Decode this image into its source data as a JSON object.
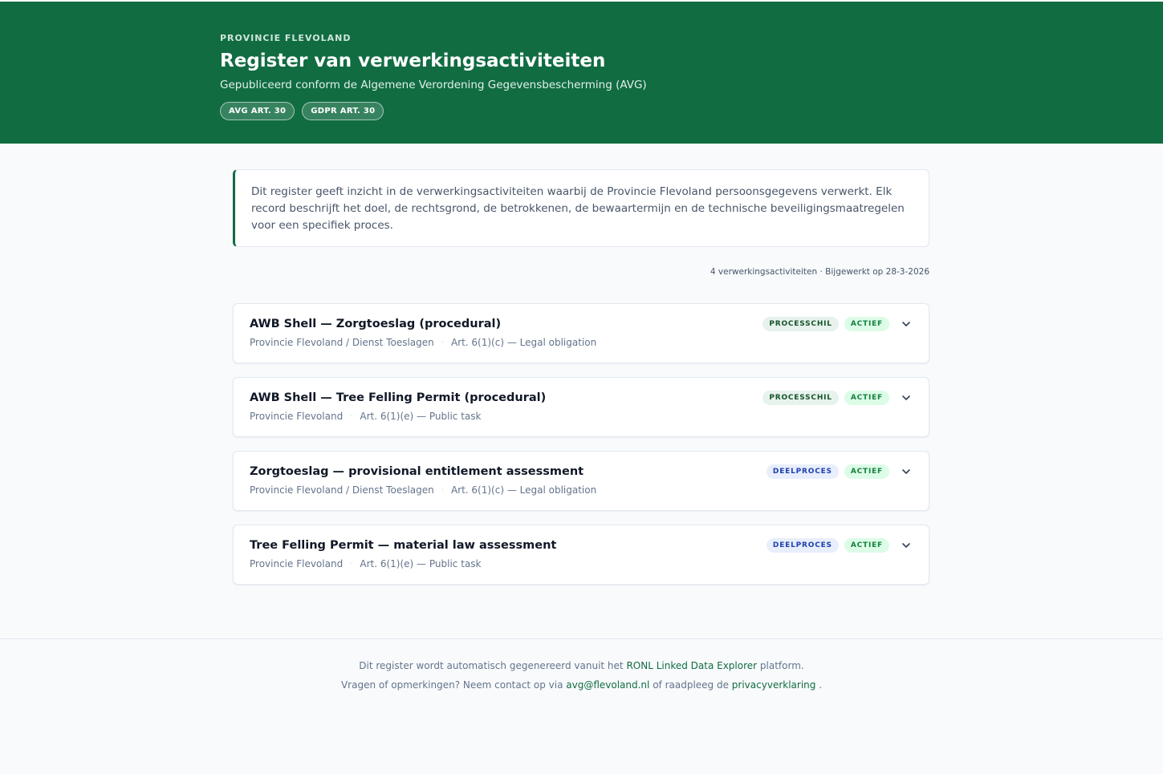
{
  "header": {
    "organization": "PROVINCIE FLEVOLAND",
    "title": "Register van verwerkingsactiviteiten",
    "subtitle": "Gepubliceerd conform de Algemene Verordening Gegevensbescherming (AVG)",
    "badges": [
      "AVG ART. 30",
      "GDPR ART. 30"
    ]
  },
  "intro": "Dit register geeft inzicht in de verwerkingsactiviteiten waarbij de Provincie Flevoland persoonsgegevens verwerkt. Elk record beschrijft het doel, de rechtsgrond, de betrokkenen, de bewaartermijn en de technische beveiligingsmaatregelen voor een specifiek proces.",
  "meta": "4 verwerkingsactiviteiten · Bijgewerkt op 28-3-2026",
  "activities": [
    {
      "title": "AWB Shell — Zorgtoeslag (procedural)",
      "organization": "Provincie Flevoland / Dienst Toeslagen",
      "legal_basis": "Art. 6(1)(c) — Legal obligation",
      "type_tag": "PROCESSCHIL",
      "status_tag": "ACTIEF"
    },
    {
      "title": "AWB Shell — Tree Felling Permit (procedural)",
      "organization": "Provincie Flevoland",
      "legal_basis": "Art. 6(1)(e) — Public task",
      "type_tag": "PROCESSCHIL",
      "status_tag": "ACTIEF"
    },
    {
      "title": "Zorgtoeslag — provisional entitlement assessment",
      "organization": "Provincie Flevoland / Dienst Toeslagen",
      "legal_basis": "Art. 6(1)(c) — Legal obligation",
      "type_tag": "DEELPROCES",
      "status_tag": "ACTIEF"
    },
    {
      "title": "Tree Felling Permit — material law assessment",
      "organization": "Provincie Flevoland",
      "legal_basis": "Art. 6(1)(e) — Public task",
      "type_tag": "DEELPROCES",
      "status_tag": "ACTIEF"
    }
  ],
  "footer": {
    "line1_prefix": "Dit register wordt automatisch gegenereerd vanuit het ",
    "line1_link": "RONL Linked Data Explorer",
    "line1_suffix": " platform.",
    "line2_prefix": "Vragen of opmerkingen? Neem contact op via ",
    "line2_email": "avg@flevoland.nl",
    "line2_middle": " of raadpleeg de ",
    "line2_link": "privacyverklaring",
    "line2_suffix": " ."
  },
  "colors": {
    "brand": "#116c42",
    "background": "#f8fafc",
    "tag_processchil": "#e8f2ec",
    "tag_deelproces": "#e8eefb",
    "tag_actief": "#dcfce7"
  },
  "icons": {
    "expand": "chevron-down-icon"
  }
}
